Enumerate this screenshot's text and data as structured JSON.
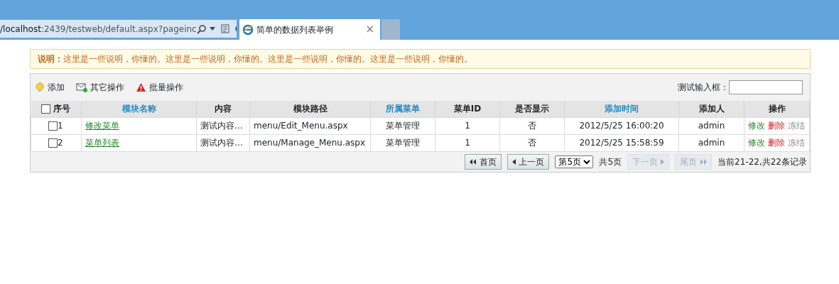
{
  "browser": {
    "address_host": "/localhost",
    "address_path": ":2439/testweb/default.aspx?pageinc",
    "tab_title": "简单的数据列表举例",
    "tab_close": "×"
  },
  "notice": {
    "label": "说明：",
    "text": "这里是一些说明，你懂的。这里是一些说明，你懂的。这里是一些说明，你懂的。这里是一些说明，你懂的。"
  },
  "toolbar": {
    "actions": [
      {
        "kind": "add",
        "label": "添加"
      },
      {
        "kind": "mail",
        "label": "其它操作"
      },
      {
        "kind": "warning",
        "label": "批量操作"
      }
    ],
    "input_label": "测试输入框："
  },
  "table": {
    "select_all": {
      "checked": false
    },
    "columns": [
      {
        "label": "序号",
        "sortable": false
      },
      {
        "label": "模块名称",
        "sortable": true
      },
      {
        "label": "内容",
        "sortable": false
      },
      {
        "label": "模块路径",
        "sortable": false
      },
      {
        "label": "所属菜单",
        "sortable": true
      },
      {
        "label": "菜单ID",
        "sortable": false
      },
      {
        "label": "是否显示",
        "sortable": false
      },
      {
        "label": "添加时间",
        "sortable": true
      },
      {
        "label": "添加人",
        "sortable": false
      },
      {
        "label": "操作",
        "sortable": false
      }
    ],
    "rows": [
      {
        "checked": false,
        "cells": [
          "1",
          "修改菜单",
          "测试内容…",
          "menu/Edit_Menu.aspx",
          "菜单管理",
          "1",
          "否",
          "2012/5/25 16:00:20",
          "admin"
        ],
        "actions": [
          {
            "kind": "edit",
            "label": "修改"
          },
          {
            "kind": "delete",
            "label": "删除"
          },
          {
            "kind": "freeze",
            "label": "冻结"
          }
        ]
      },
      {
        "checked": false,
        "cells": [
          "2",
          "菜单列表",
          "测试内容…",
          "menu/Manage_Menu.aspx",
          "菜单管理",
          "1",
          "否",
          "2012/5/25 15:58:59",
          "admin"
        ],
        "actions": [
          {
            "kind": "edit",
            "label": "修改"
          },
          {
            "kind": "delete",
            "label": "删除"
          },
          {
            "kind": "freeze",
            "label": "冻结"
          }
        ]
      }
    ]
  },
  "pager": {
    "first": {
      "label": "首页",
      "disabled": false
    },
    "prev": {
      "label": "上一页",
      "disabled": false
    },
    "page_select": "第5页",
    "total_pages": "共5页",
    "next": {
      "label": "下一页",
      "disabled": true
    },
    "last": {
      "label": "尾页",
      "disabled": true
    },
    "summary": "当前21-22,共22条记录"
  }
}
